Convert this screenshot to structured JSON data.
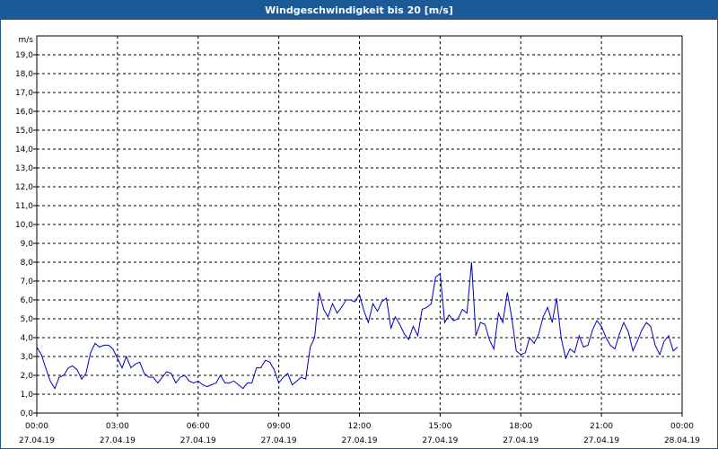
{
  "window": {
    "title": "Windgeschwindigkeit bis 20 [m/s]"
  },
  "colors": {
    "title_bar": "#1b5a96",
    "line": "#0000c0",
    "grid": "#000000"
  },
  "chart_data": {
    "type": "line",
    "title": "Windgeschwindigkeit bis 20 [m/s]",
    "xlabel": "",
    "ylabel": "m/s",
    "grid": true,
    "ylim": [
      0,
      20
    ],
    "xlim_hours": [
      0,
      24
    ],
    "y_ticks": [
      "0,0",
      "1,0",
      "2,0",
      "3,0",
      "4,0",
      "5,0",
      "6,0",
      "7,0",
      "8,0",
      "9,0",
      "10,0",
      "11,0",
      "12,0",
      "13,0",
      "14,0",
      "15,0",
      "16,0",
      "17,0",
      "18,0",
      "19,0"
    ],
    "x_ticks": [
      {
        "time": "00:00",
        "date": "27.04.19"
      },
      {
        "time": "03:00",
        "date": "27.04.19"
      },
      {
        "time": "06:00",
        "date": "27.04.19"
      },
      {
        "time": "09:00",
        "date": "27.04.19"
      },
      {
        "time": "12:00",
        "date": "27.04.19"
      },
      {
        "time": "15:00",
        "date": "27.04.19"
      },
      {
        "time": "18:00",
        "date": "27.04.19"
      },
      {
        "time": "21:00",
        "date": "27.04.19"
      },
      {
        "time": "00:00",
        "date": "28.04.19"
      }
    ],
    "series": [
      {
        "x_hours": [
          0.0,
          0.17,
          0.33,
          0.5,
          0.67,
          0.83,
          1.0,
          1.17,
          1.33,
          1.5,
          1.67,
          1.83,
          2.0,
          2.17,
          2.33,
          2.5,
          2.67,
          2.83,
          3.0,
          3.17,
          3.33,
          3.5,
          3.67,
          3.83,
          4.0,
          4.17,
          4.33,
          4.5,
          4.67,
          4.83,
          5.0,
          5.17,
          5.33,
          5.5,
          5.67,
          5.83,
          6.0,
          6.17,
          6.33,
          6.5,
          6.67,
          6.83,
          7.0,
          7.17,
          7.33,
          7.5,
          7.67,
          7.83,
          8.0,
          8.17,
          8.33,
          8.5,
          8.67,
          8.83,
          9.0,
          9.17,
          9.33,
          9.5,
          9.67,
          9.83,
          10.0,
          10.17,
          10.33,
          10.5,
          10.67,
          10.83,
          11.0,
          11.17,
          11.33,
          11.5,
          11.67,
          11.83,
          12.0,
          12.17,
          12.33,
          12.5,
          12.67,
          12.83,
          13.0,
          13.17,
          13.33,
          13.5,
          13.67,
          13.83,
          14.0,
          14.17,
          14.33,
          14.5,
          14.67,
          14.83,
          15.0,
          15.17,
          15.33,
          15.5,
          15.67,
          15.83,
          16.0,
          16.17,
          16.33,
          16.5,
          16.67,
          16.83,
          17.0,
          17.17,
          17.33,
          17.5,
          17.67,
          17.83,
          18.0,
          18.17,
          18.33,
          18.5,
          18.67,
          18.83,
          19.0,
          19.17,
          19.33,
          19.5,
          19.67,
          19.83,
          20.0,
          20.17,
          20.33,
          20.5,
          20.67,
          20.83,
          21.0,
          21.17,
          21.33,
          21.5,
          21.67,
          21.83,
          22.0,
          22.17,
          22.33,
          22.5,
          22.67,
          22.83,
          23.0,
          23.17,
          23.33,
          23.5,
          23.67,
          23.83
        ],
        "values": [
          3.5,
          3.1,
          2.4,
          1.7,
          1.3,
          1.9,
          2.0,
          2.4,
          2.5,
          2.3,
          1.8,
          2.1,
          3.2,
          3.7,
          3.5,
          3.6,
          3.6,
          3.4,
          2.9,
          2.4,
          3.0,
          2.4,
          2.6,
          2.7,
          2.1,
          1.9,
          1.9,
          1.6,
          1.9,
          2.2,
          2.1,
          1.6,
          1.9,
          2.0,
          1.7,
          1.6,
          1.7,
          1.5,
          1.4,
          1.5,
          1.6,
          2.0,
          1.6,
          1.6,
          1.7,
          1.5,
          1.3,
          1.6,
          1.6,
          2.4,
          2.4,
          2.8,
          2.7,
          2.3,
          1.6,
          1.9,
          2.1,
          1.5,
          1.7,
          1.9,
          1.8,
          3.5,
          4.0,
          6.4,
          5.5,
          5.1,
          5.8,
          5.3,
          5.6,
          6.0,
          6.0,
          5.9,
          6.3,
          5.4,
          4.8,
          5.8,
          5.4,
          5.9,
          6.1,
          4.5,
          5.1,
          4.7,
          4.2,
          3.9,
          4.6,
          4.1,
          5.5,
          5.6,
          5.8,
          7.2,
          7.4,
          4.8,
          5.2,
          4.9,
          5.0,
          5.5,
          5.3,
          8.0,
          4.1,
          4.8,
          4.7,
          3.9,
          3.4,
          5.3,
          4.8,
          6.4,
          5.0,
          3.3,
          3.1,
          3.2,
          4.0,
          3.7,
          4.2,
          5.1,
          5.6,
          4.8,
          6.1,
          4.0,
          2.9,
          3.4,
          3.2,
          4.1,
          3.5,
          3.6,
          4.4,
          4.9,
          4.6,
          4.0,
          3.6,
          3.4,
          4.2,
          4.8,
          4.3,
          3.3,
          3.8,
          4.4,
          4.8,
          4.6,
          3.6,
          3.1,
          3.8,
          4.1,
          3.3,
          3.5
        ]
      }
    ]
  }
}
